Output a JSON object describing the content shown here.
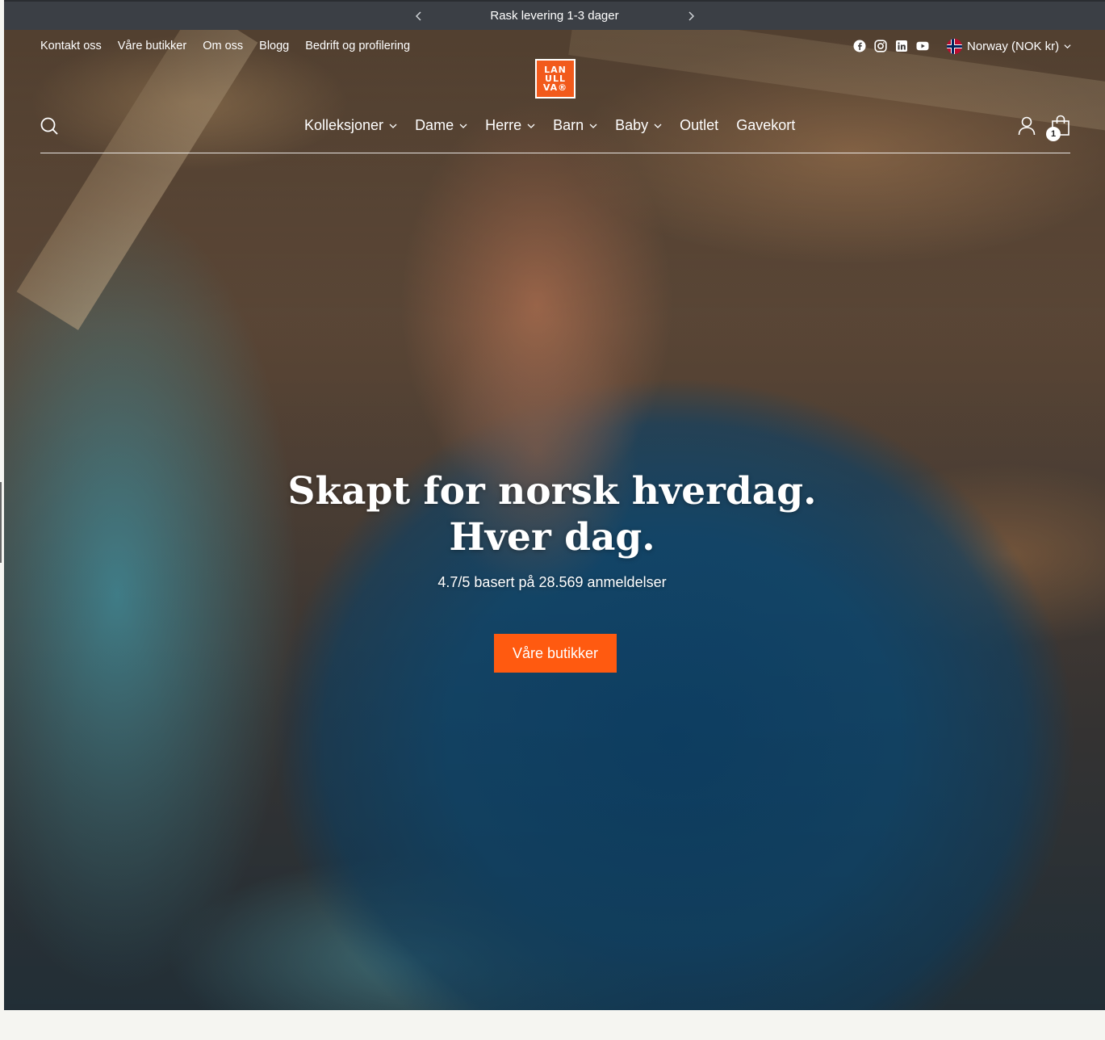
{
  "announcement": {
    "text": "Rask levering 1-3 dager",
    "prev_icon": "chevron-left-icon",
    "next_icon": "chevron-right-icon"
  },
  "utility_nav": {
    "items": [
      {
        "label": "Kontakt oss"
      },
      {
        "label": "Våre butikker"
      },
      {
        "label": "Om oss"
      },
      {
        "label": "Blogg"
      },
      {
        "label": "Bedrift og profilering"
      }
    ]
  },
  "socials": [
    "facebook-icon",
    "instagram-icon",
    "linkedin-icon",
    "youtube-icon"
  ],
  "country_selector": {
    "label": "Norway (NOK kr)",
    "flag": "norway-flag-icon"
  },
  "logo": {
    "lines": [
      "LAN",
      "ULL",
      "VA®"
    ],
    "color": "#f25a1c"
  },
  "main_nav": {
    "items": [
      {
        "label": "Kolleksjoner",
        "has_dropdown": true
      },
      {
        "label": "Dame",
        "has_dropdown": true
      },
      {
        "label": "Herre",
        "has_dropdown": true
      },
      {
        "label": "Barn",
        "has_dropdown": true
      },
      {
        "label": "Baby",
        "has_dropdown": true
      },
      {
        "label": "Outlet",
        "has_dropdown": false
      },
      {
        "label": "Gavekort",
        "has_dropdown": false
      }
    ]
  },
  "header_icons": {
    "search": "search-icon",
    "account": "account-icon",
    "cart": "shopping-bag-icon",
    "cart_count": "1"
  },
  "hero": {
    "headline_line1": "Skapt for norsk hverdag.",
    "headline_line2": "Hver dag.",
    "rating": "4.7/5 basert på 28.569 anmeldelser",
    "cta_label": "Våre butikker",
    "cta_color": "#ff5a10"
  }
}
